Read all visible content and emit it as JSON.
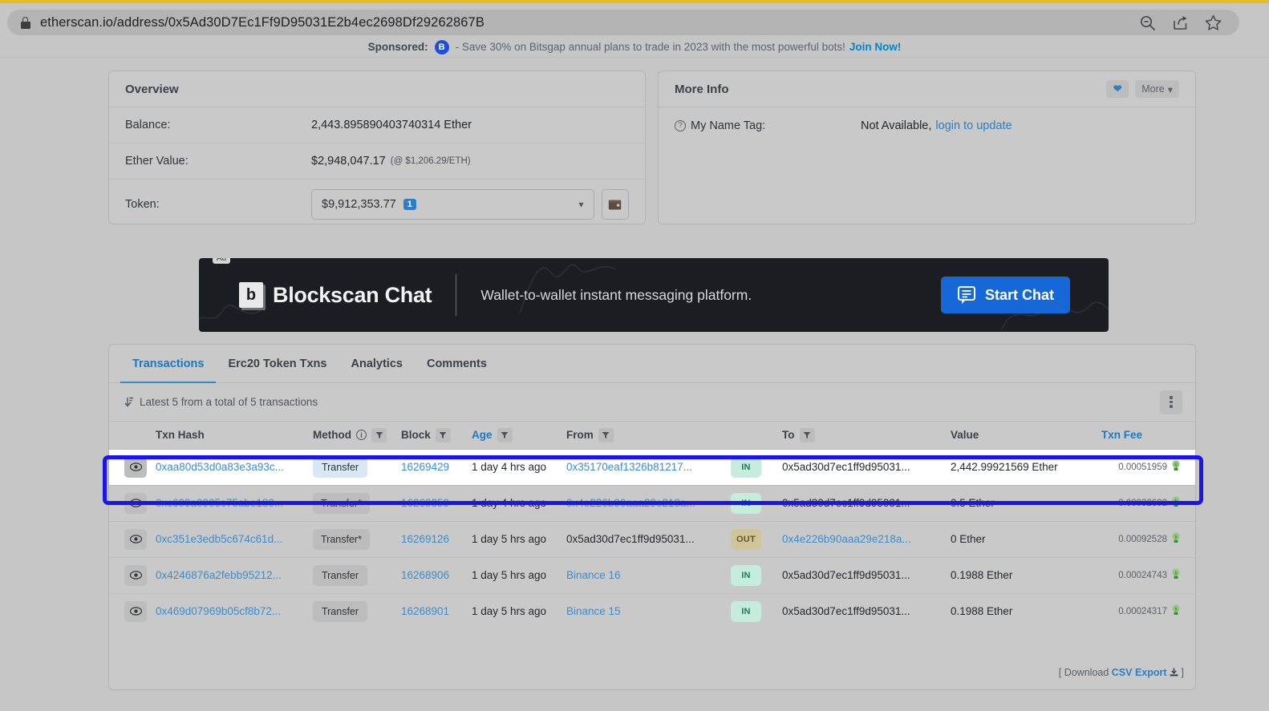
{
  "browser": {
    "url": "etherscan.io/address/0x5Ad30D7Ec1Ff9D95031E2b4ec2698Df29262867B",
    "lock_icon": "lock-icon",
    "zoom_out_icon": "zoom-out-icon",
    "share_icon": "share-icon",
    "bookmark_icon": "star-icon"
  },
  "sponsored": {
    "label": "Sponsored:",
    "badge": "B",
    "text": "- Save 30% on Bitsgap annual plans to trade in 2023 with the most powerful bots!",
    "cta": "Join Now!"
  },
  "overview": {
    "title": "Overview",
    "balance_label": "Balance:",
    "balance_value": "2,443.895890403740314 Ether",
    "ether_value_label": "Ether Value:",
    "ether_value": "$2,948,047.17",
    "ether_rate": "(@ $1,206.29/ETH)",
    "token_label": "Token:",
    "token_value": "$9,912,353.77",
    "token_count": "1",
    "wallet_icon": "wallet-icon",
    "caret_icon": "chevron-down-icon"
  },
  "more_info": {
    "title": "More Info",
    "heart_icon": "heart-icon",
    "more_label": "More",
    "name_tag_label": "My Name Tag:",
    "name_tag_value": "Not Available,",
    "name_tag_link": "login to update"
  },
  "ad": {
    "tag": "Ad",
    "logo_letter": "b",
    "brand": "Blockscan Chat",
    "tagline": "Wallet-to-wallet instant messaging platform.",
    "cta": "Start Chat",
    "cta_icon": "chat-icon",
    "bg_color": "#1b1d23",
    "cta_color": "#1668d8"
  },
  "tabs": [
    {
      "label": "Transactions",
      "active": true
    },
    {
      "label": "Erc20 Token Txns",
      "active": false
    },
    {
      "label": "Analytics",
      "active": false
    },
    {
      "label": "Comments",
      "active": false
    }
  ],
  "tx_meta": {
    "sort_icon": "sort-descending-icon",
    "text": "Latest 5 from a total of 5 transactions",
    "kebab_icon": "more-vertical-icon"
  },
  "table": {
    "columns": [
      {
        "key": "eye",
        "label": "",
        "filter": false,
        "info": false,
        "sortable": false
      },
      {
        "key": "hash",
        "label": "Txn Hash",
        "filter": false,
        "info": false,
        "sortable": false
      },
      {
        "key": "method",
        "label": "Method",
        "filter": true,
        "info": true,
        "sortable": false
      },
      {
        "key": "block",
        "label": "Block",
        "filter": true,
        "info": false,
        "sortable": false
      },
      {
        "key": "age",
        "label": "Age",
        "filter": true,
        "info": false,
        "sortable": true
      },
      {
        "key": "from",
        "label": "From",
        "filter": true,
        "info": false,
        "sortable": false
      },
      {
        "key": "dir",
        "label": "",
        "filter": false,
        "info": false,
        "sortable": false
      },
      {
        "key": "to",
        "label": "To",
        "filter": true,
        "info": false,
        "sortable": false
      },
      {
        "key": "value",
        "label": "Value",
        "filter": false,
        "info": false,
        "sortable": false
      },
      {
        "key": "fee",
        "label": "Txn Fee",
        "filter": false,
        "info": false,
        "sortable": true
      }
    ],
    "rows": [
      {
        "hash": "0xaa80d53d0a83e3a93c...",
        "method": "Transfer",
        "method_highlight": true,
        "block": "16269429",
        "age": "1 day 4 hrs ago",
        "from": "0x35170eaf1326b81217...",
        "from_link": true,
        "dir": "IN",
        "to": "0x5ad30d7ec1ff9d95031...",
        "to_link": false,
        "value": "2,442.99921569 Ether",
        "fee": "0.00051959",
        "highlighted": true
      },
      {
        "hash": "0xc609a0905c75abe180...",
        "method": "Transfer*",
        "method_highlight": false,
        "block": "16269359",
        "age": "1 day 4 hrs ago",
        "from": "0x4e226b90aaa29e218a...",
        "from_link": true,
        "dir": "IN",
        "to": "0x5ad30d7ec1ff9d95031...",
        "to_link": false,
        "value": "0.5 Ether",
        "fee": "0.00032692",
        "highlighted": false
      },
      {
        "hash": "0xc351e3edb5c674c61d...",
        "method": "Transfer*",
        "method_highlight": false,
        "block": "16269126",
        "age": "1 day 5 hrs ago",
        "from": "0x5ad30d7ec1ff9d95031...",
        "from_link": false,
        "dir": "OUT",
        "to": "0x4e226b90aaa29e218a...",
        "to_link": true,
        "value": "0 Ether",
        "fee": "0.00092528",
        "highlighted": false
      },
      {
        "hash": "0x4246876a2febb95212...",
        "method": "Transfer",
        "method_highlight": false,
        "block": "16268906",
        "age": "1 day 5 hrs ago",
        "from": "Binance 16",
        "from_link": true,
        "dir": "IN",
        "to": "0x5ad30d7ec1ff9d95031...",
        "to_link": false,
        "value": "0.1988 Ether",
        "fee": "0.00024743",
        "highlighted": false
      },
      {
        "hash": "0x469d07969b05cf8b72...",
        "method": "Transfer",
        "method_highlight": false,
        "block": "16268901",
        "age": "1 day 5 hrs ago",
        "from": "Binance 15",
        "from_link": true,
        "dir": "IN",
        "to": "0x5ad30d7ec1ff9d95031...",
        "to_link": false,
        "value": "0.1988 Ether",
        "fee": "0.00024317",
        "highlighted": false
      }
    ],
    "eye_icon": "eye-icon",
    "gas_icon": "gas-icon",
    "filter_icon": "funnel-icon"
  },
  "footer": {
    "bracket_open": "[",
    "download_label": "Download",
    "csv_label": "CSV Export",
    "download_icon": "download-icon",
    "bracket_close": "]"
  },
  "colors": {
    "highlight_ring": "#1a14f0",
    "link": "#3c8dcb",
    "in_badge_bg": "#c5ecdd",
    "out_badge_bg": "#cfc49a"
  }
}
